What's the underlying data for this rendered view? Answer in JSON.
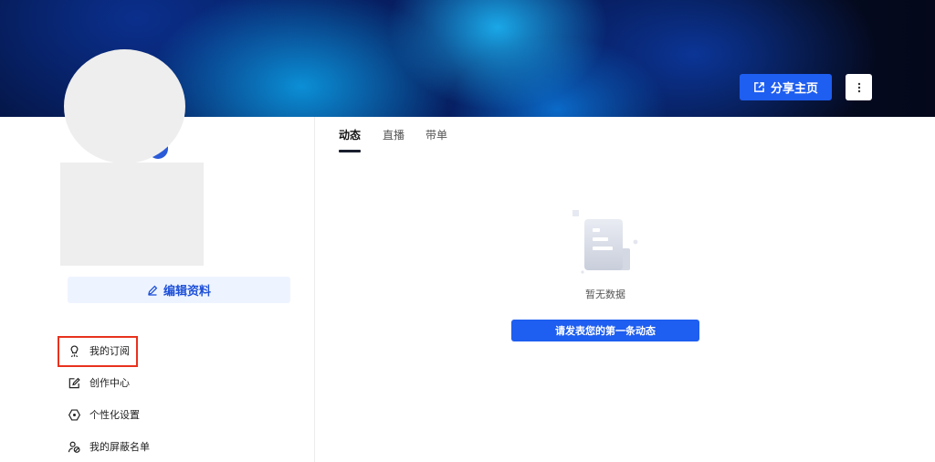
{
  "header": {
    "share_label": "分享主页"
  },
  "profile": {
    "edit_label": "编辑资料"
  },
  "sidebar": {
    "items": [
      {
        "label": "我的订阅",
        "icon": "subscription-icon"
      },
      {
        "label": "创作中心",
        "icon": "creator-center-icon"
      },
      {
        "label": "个性化设置",
        "icon": "settings-hexagon-icon"
      },
      {
        "label": "我的屏蔽名单",
        "icon": "block-list-icon"
      }
    ]
  },
  "tabs": [
    {
      "label": "动态",
      "active": true
    },
    {
      "label": "直播",
      "active": false
    },
    {
      "label": "带单",
      "active": false
    }
  ],
  "empty_state": {
    "text": "暂无数据",
    "button_label": "请发表您的第一条动态",
    "icon": "empty-document-icon"
  },
  "colors": {
    "primary": "#1e5ef0",
    "highlight": "#e8321e",
    "edit_bg": "#eef4ff"
  }
}
